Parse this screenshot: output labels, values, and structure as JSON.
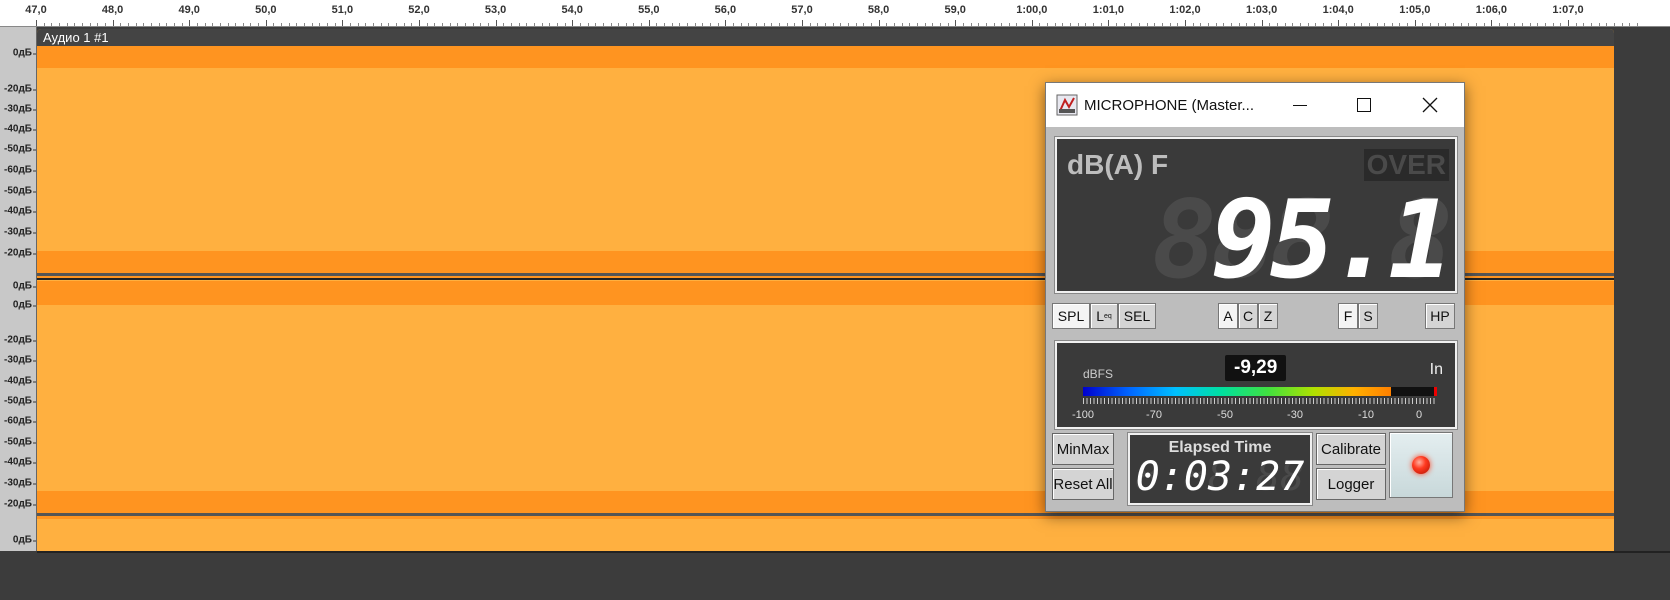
{
  "ruler": {
    "ticks": [
      "47,0",
      "48,0",
      "49,0",
      "50,0",
      "51,0",
      "52,0",
      "53,0",
      "54,0",
      "55,0",
      "56,0",
      "57,0",
      "58,0",
      "59,0",
      "1:00,0",
      "1:01,0",
      "1:02,0",
      "1:03,0",
      "1:04,0",
      "1:05,0",
      "1:06,0",
      "1:07,0"
    ]
  },
  "db_scale": {
    "top_labels": [
      "0дБ",
      "-20дБ",
      "-30дБ",
      "-40дБ",
      "-50дБ",
      "-60дБ",
      "-50дБ",
      "-40дБ",
      "-30дБ",
      "-20дБ",
      "0дБ"
    ],
    "bottom_labels": [
      "0дБ",
      "-20дБ",
      "-30дБ",
      "-40дБ",
      "-50дБ",
      "-60дБ",
      "-50дБ",
      "-40дБ",
      "-30дБ",
      "-20дБ",
      "0дБ"
    ]
  },
  "track": {
    "title": "Аудио 1 #1",
    "colors": {
      "waveform": "#ffb040",
      "peaks": "#ff9420"
    }
  },
  "meter_window": {
    "title": "MICROPHONE (Master...",
    "weighting_label": "dB(A) F",
    "over_label": "OVER",
    "ghost_digits": "888.8",
    "reading": "95.1",
    "mode_buttons": [
      "SPL",
      "L",
      "eq",
      "SEL"
    ],
    "weighting_buttons": [
      "A",
      "C",
      "Z"
    ],
    "time_buttons": [
      "F",
      "S"
    ],
    "hp_button": "HP",
    "dbfs_label": "dBFS",
    "dbfs_value": "-9,29",
    "input_label": "In",
    "level_percent": 87,
    "scale_labels": [
      "-100",
      "-70",
      "-50",
      "-30",
      "-10",
      "0"
    ],
    "minmax_button": "MinMax",
    "reset_button": "Reset All",
    "elapsed_title": "Elapsed Time",
    "elapsed_ghost": "8:88:88",
    "elapsed_value": "0:03:27",
    "calibrate_button": "Calibrate",
    "logger_button": "Logger"
  }
}
